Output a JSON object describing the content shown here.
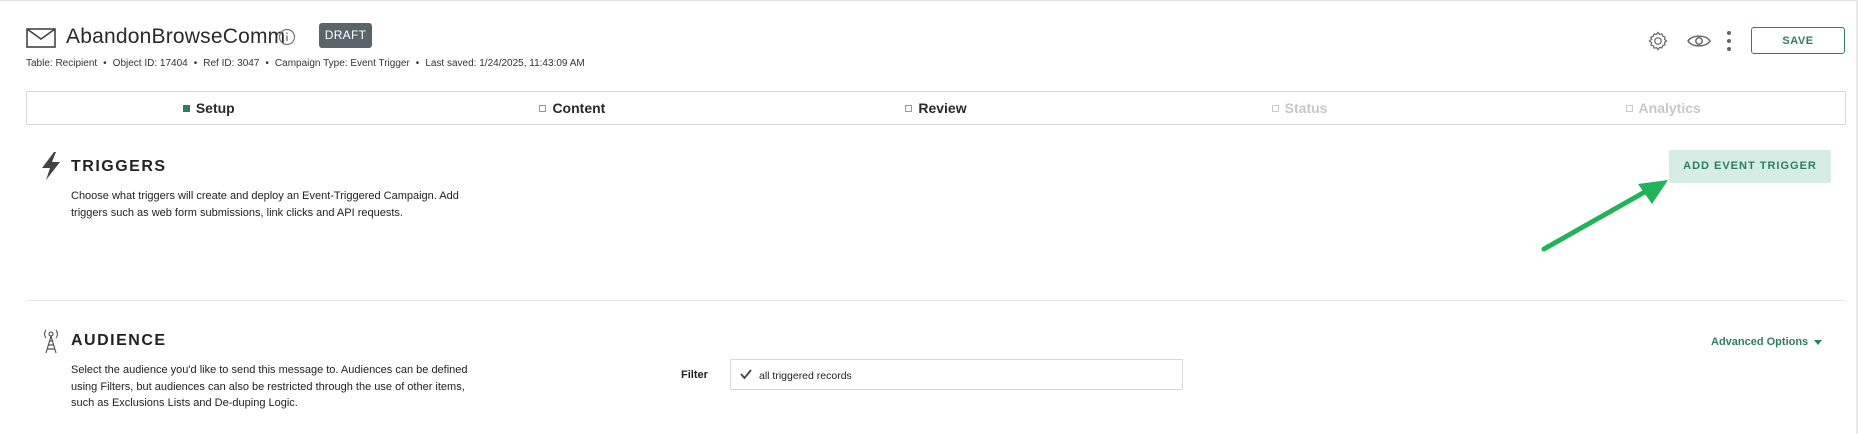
{
  "header": {
    "title": "AbandonBrowseComm",
    "status_badge": "DRAFT",
    "meta": {
      "table": "Table: Recipient",
      "object_id": "Object ID: 17404",
      "ref_id": "Ref ID: 3047",
      "campaign_type": "Campaign Type: Event Trigger",
      "last_saved": "Last saved: 1/24/2025, 11:43:09 AM",
      "separator": "•"
    },
    "save_label": "SAVE"
  },
  "tabs": [
    {
      "label": "Setup",
      "state": "active"
    },
    {
      "label": "Content",
      "state": "pending"
    },
    {
      "label": "Review",
      "state": "pending"
    },
    {
      "label": "Status",
      "state": "disabled"
    },
    {
      "label": "Analytics",
      "state": "disabled"
    }
  ],
  "triggers": {
    "title": "TRIGGERS",
    "description": "Choose what triggers will create and deploy an Event-Triggered Campaign. Add triggers such as web form submissions, link clicks and API requests.",
    "add_button": "ADD EVENT TRIGGER"
  },
  "audience": {
    "title": "AUDIENCE",
    "description": "Select the audience you'd like to send this message to. Audiences can be defined using Filters, but audiences can also be restricted through the use of other items, such as Exclusions Lists and De-duping Logic.",
    "advanced_options": "Advanced Options",
    "filter_label": "Filter",
    "filter_value": "all triggered records"
  },
  "colors": {
    "accent": "#2e7d63",
    "badge_bg": "#5a6569",
    "button_light_bg": "#d5ede4",
    "annotation_arrow": "#22b35a"
  },
  "icons": [
    "mail-icon",
    "info-icon",
    "gear-icon",
    "eye-icon",
    "kebab-menu-icon",
    "bolt-icon",
    "antenna-tower-icon",
    "check-icon",
    "chevron-down-icon"
  ]
}
